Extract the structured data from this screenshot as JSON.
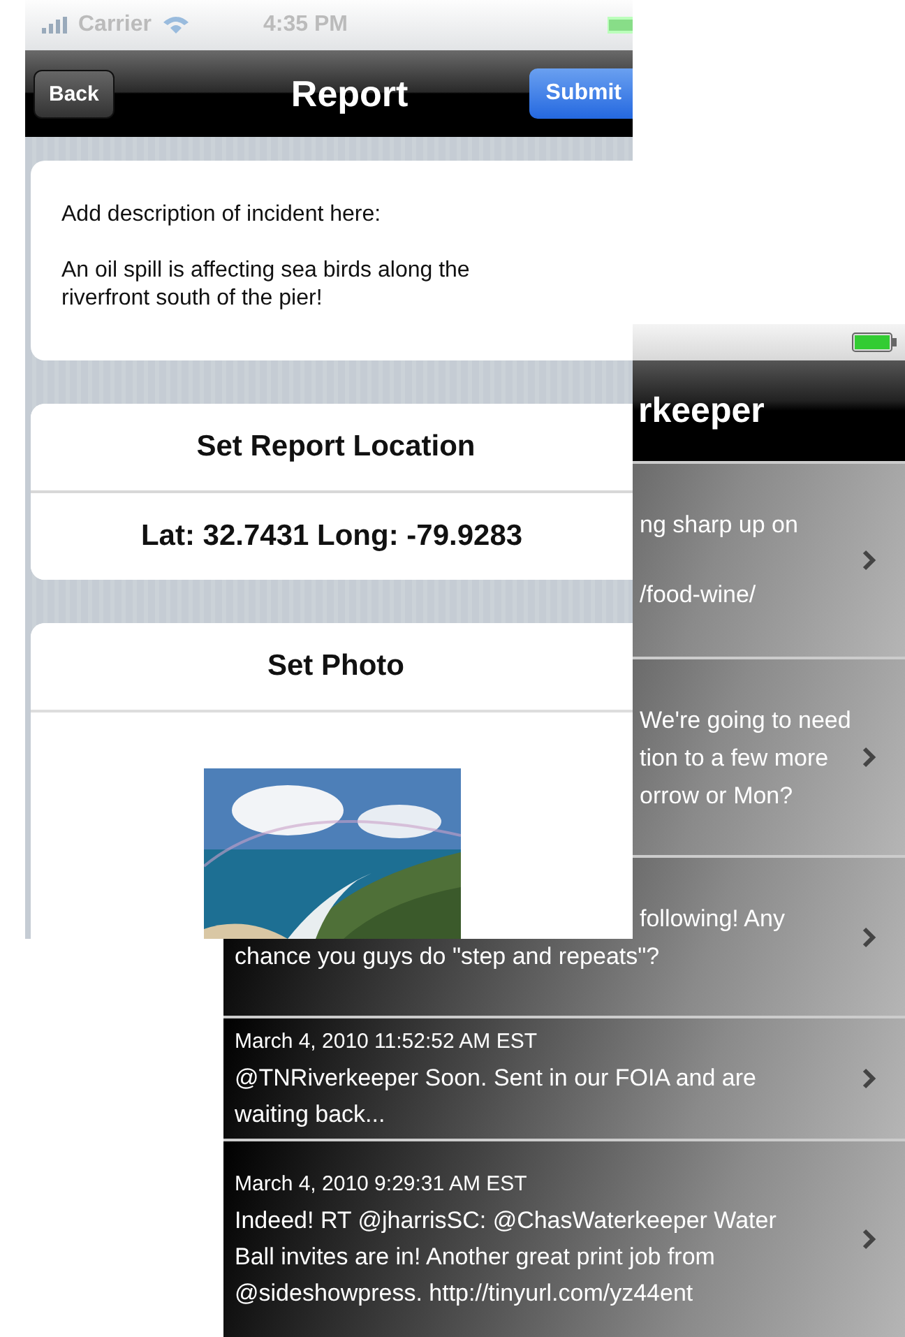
{
  "feed_screen": {
    "nav_bar": {
      "title": "rkeeper"
    },
    "tweets": [
      {
        "lines": [
          {
            "text": "ng sharp up on",
            "cut": true
          },
          {
            "text": "/food-wine/",
            "cut": true
          }
        ]
      },
      {
        "lines": [
          {
            "text": "We're going to need",
            "cut": true
          },
          {
            "text": "tion to a few more",
            "cut": true
          },
          {
            "text": "orrow or Mon?",
            "cut": true
          }
        ]
      },
      {
        "lines": [
          {
            "text": "following!  Any",
            "cut": true
          },
          {
            "text": "chance you guys do \"step and repeats\"?",
            "cut": false
          }
        ]
      },
      {
        "date": "March 4, 2010 11:52:52 AM EST",
        "lines": [
          {
            "text": "@TNRiverkeeper Soon.  Sent in our FOIA and are",
            "cut": false
          },
          {
            "text": "waiting back...",
            "cut": false
          }
        ]
      },
      {
        "date": "March 4, 2010 9:29:31 AM EST",
        "lines": [
          {
            "text": "Indeed! RT @jharrisSC: @ChasWaterkeeper Water",
            "cut": false
          },
          {
            "text": "Ball invites are in! Another great print job from",
            "cut": false
          },
          {
            "text": "@sideshowpress. http://tinyurl.com/yz44ent",
            "cut": false
          }
        ]
      }
    ]
  },
  "report_screen": {
    "status_bar": {
      "carrier": "Carrier",
      "time": "4:35 PM"
    },
    "nav_bar": {
      "back": "Back",
      "title": "Report",
      "submit": "Submit"
    },
    "description": {
      "value": "Add description of incident here:\n\nAn oil spill is affecting sea birds along the\nriverfront south of the pier!"
    },
    "location": {
      "button": "Set Report Location",
      "coordinates": "Lat: 32.7431 Long: -79.9283"
    },
    "photo": {
      "button": "Set Photo"
    }
  }
}
